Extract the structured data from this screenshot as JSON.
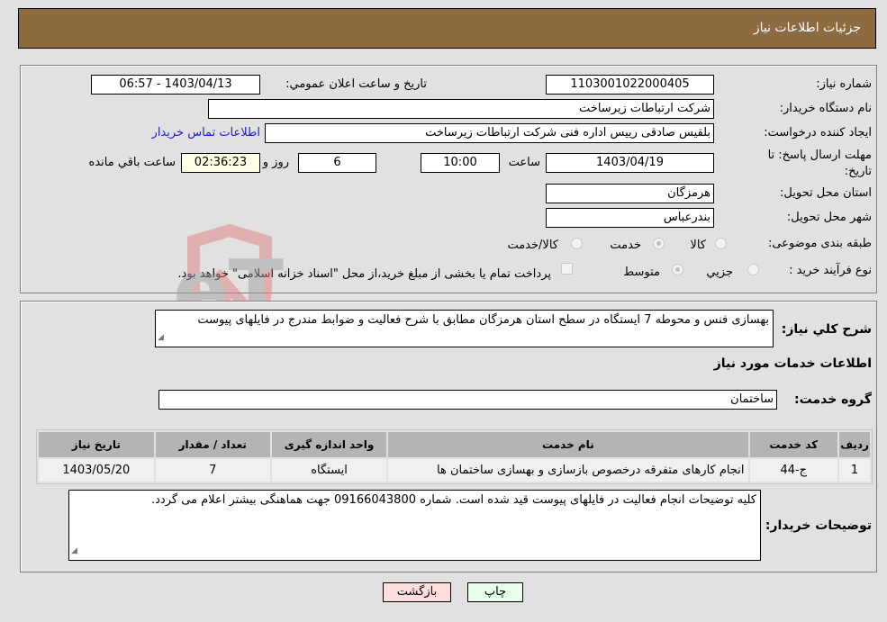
{
  "header": {
    "title": "جزئیات اطلاعات نیاز"
  },
  "form": {
    "need_number_label": "شماره نیاز:",
    "need_number": "1103001022000405",
    "announce_label": "تاریخ و ساعت اعلان عمومي:",
    "announce_value": "1403/04/13 - 06:57",
    "buyer_org_label": "نام دستگاه خریدار:",
    "buyer_org": "شرکت ارتباطات زیرساخت",
    "creator_label": "ایجاد کننده درخواست:",
    "creator": "بلقیس صادقی رییس اداره فنی شرکت ارتباطات زیرساخت",
    "contact_link": "اطلاعات تماس خریدار",
    "deadline_label_line1": "مهلت ارسال پاسخ: تا",
    "deadline_label_line2": "تاریخ:",
    "deadline_date": "1403/04/19",
    "time_label": "ساعت",
    "deadline_time": "10:00",
    "days_value": "6",
    "days_label": "روز و",
    "remaining_value": "02:36:23",
    "remaining_label": "ساعت باقي مانده",
    "province_label": "استان محل تحویل:",
    "province": "هرمزگان",
    "city_label": "شهر محل تحویل:",
    "city": "بندرعباس",
    "category_label": "طبقه بندی موضوعی:",
    "category_options": [
      {
        "label": "کالا",
        "selected": false
      },
      {
        "label": "خدمت",
        "selected": true
      },
      {
        "label": "کالا/خدمت",
        "selected": false
      }
    ],
    "process_label": "نوع فرآیند خرید :",
    "process_options": [
      {
        "label": "جزيي",
        "selected": false
      },
      {
        "label": "متوسط",
        "selected": true
      }
    ],
    "treasury_checkbox_checked": false,
    "treasury_text": "پرداخت تمام یا بخشی از مبلغ خرید،از محل \"اسناد خزانه اسلامی\" خواهد بود."
  },
  "details": {
    "summary_label": "شرح كلي نياز:",
    "summary_text": "بهسازی فنس و محوطه 7 ایستگاه در سطح استان هرمزگان مطابق با شرح فعالیت و ضوابط مندرج در فایلهای پیوست",
    "services_heading": "اطلاعات خدمات مورد نیاز",
    "service_group_label": "گروه خدمت:",
    "service_group": "ساختمان",
    "table": {
      "headers": [
        "ردیف",
        "کد خدمت",
        "نام خدمت",
        "واحد اندازه گیری",
        "تعداد / مقدار",
        "تاریخ نیاز"
      ],
      "rows": [
        [
          "1",
          "ج-44",
          "انجام کارهای متفرقه درخصوص بازسازی و بهسازی ساختمان ها",
          "ایستگاه",
          "7",
          "1403/05/20"
        ]
      ]
    },
    "buyer_notes_label": "توضیحات خریدار:",
    "buyer_notes": "کلیه توضیحات انجام فعالیت در فایلهای پیوست قید شده است. شماره 09166043800 جهت هماهنگی بیشتر اعلام می گردد."
  },
  "buttons": {
    "print": "چاپ",
    "back": "بازگشت"
  },
  "watermark": {
    "text": "AriaTender.neT"
  },
  "colors": {
    "title_bar": "#8d6b41",
    "page_bg": "#e1e1e1",
    "link": "#1d1dd6",
    "print_button_bg": "#eaffea",
    "back_button_bg": "#ffdede",
    "remaining_bg": "#ffffe8",
    "table_header_bg": "#b4b4b4"
  }
}
